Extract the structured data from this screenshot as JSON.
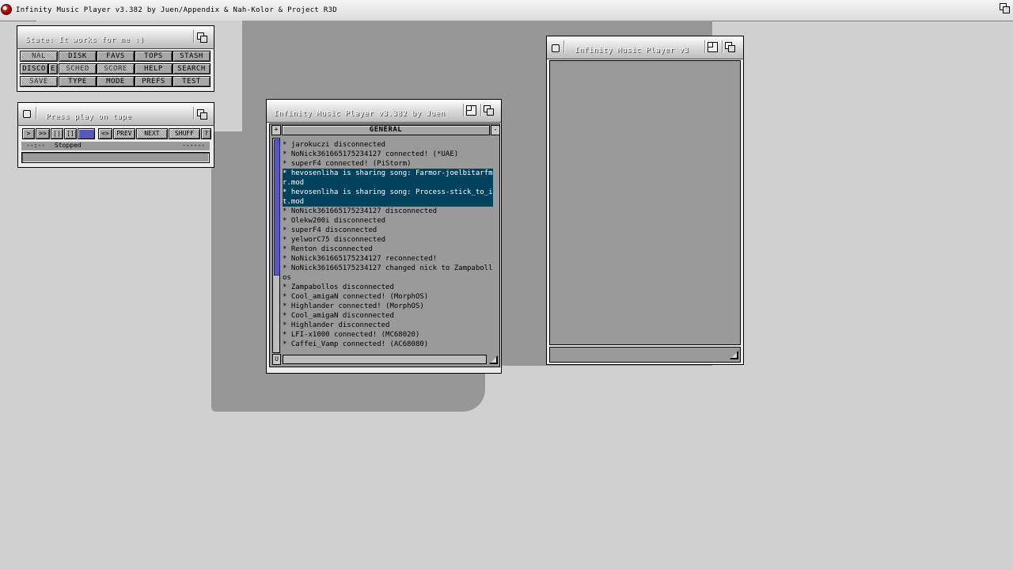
{
  "screen": {
    "title": "Infinity Music Player v3.382 by Juen/Appendix & Nah-Kolor & Project R3D"
  },
  "state_window": {
    "title": "State: It works for me :)",
    "buttons": [
      [
        "NAL",
        "DISK",
        "FAVS",
        "TOPS",
        "STASH"
      ],
      [
        "DISCO",
        "E",
        "SCHED",
        "SCORE",
        "HELP",
        "SEARCH"
      ],
      [
        "SAVE",
        "TYPE",
        "MODE",
        "PREFS",
        "TEST"
      ]
    ]
  },
  "player_window": {
    "title": "Press play on tape",
    "controls": [
      ">",
      ">>",
      "||",
      "[]",
      "",
      "<>",
      "PREV",
      "NEXT",
      "SHUFF",
      "?"
    ],
    "time": "--:--",
    "status": "Stopped",
    "extra": "------"
  },
  "chat_window": {
    "title": "Infinity Music Player v3.382 by Juen",
    "channel": "GENERAL",
    "plus_label": "+",
    "minus_label": "-",
    "u_label": "U",
    "messages": [
      "* jarokuczi disconnected",
      "* NoNick361665175234127 connected! (*UAE)",
      "* superF4 connected! (PiStorm)",
      "* hevosenliha is sharing song: Farmor-joelbitarfmr.mod",
      "* hevosenliha is sharing song: Process-stick_to_it.mod",
      "* NoNick361665175234127 disconnected",
      "* Olekw200i disconnected",
      "* superF4 disconnected",
      "* yelworC75 disconnected",
      "* Renton disconnected",
      "* NoNick361665175234127 reconnected!",
      "* NoNick361665175234127 changed nick to Zampabollos",
      "* Zampabollos disconnected",
      "* Cool_amigaN connected! (MorphOS)",
      "* Highlander connected! (MorphOS)",
      "* Cool_amigaN disconnected",
      "* Highlander disconnected",
      "* LFI-x1000 connected! (MC68020)",
      "* Caffei_Vamp connected! (AC68080)"
    ]
  },
  "right_window": {
    "title": "Infinity Music Player v3"
  }
}
